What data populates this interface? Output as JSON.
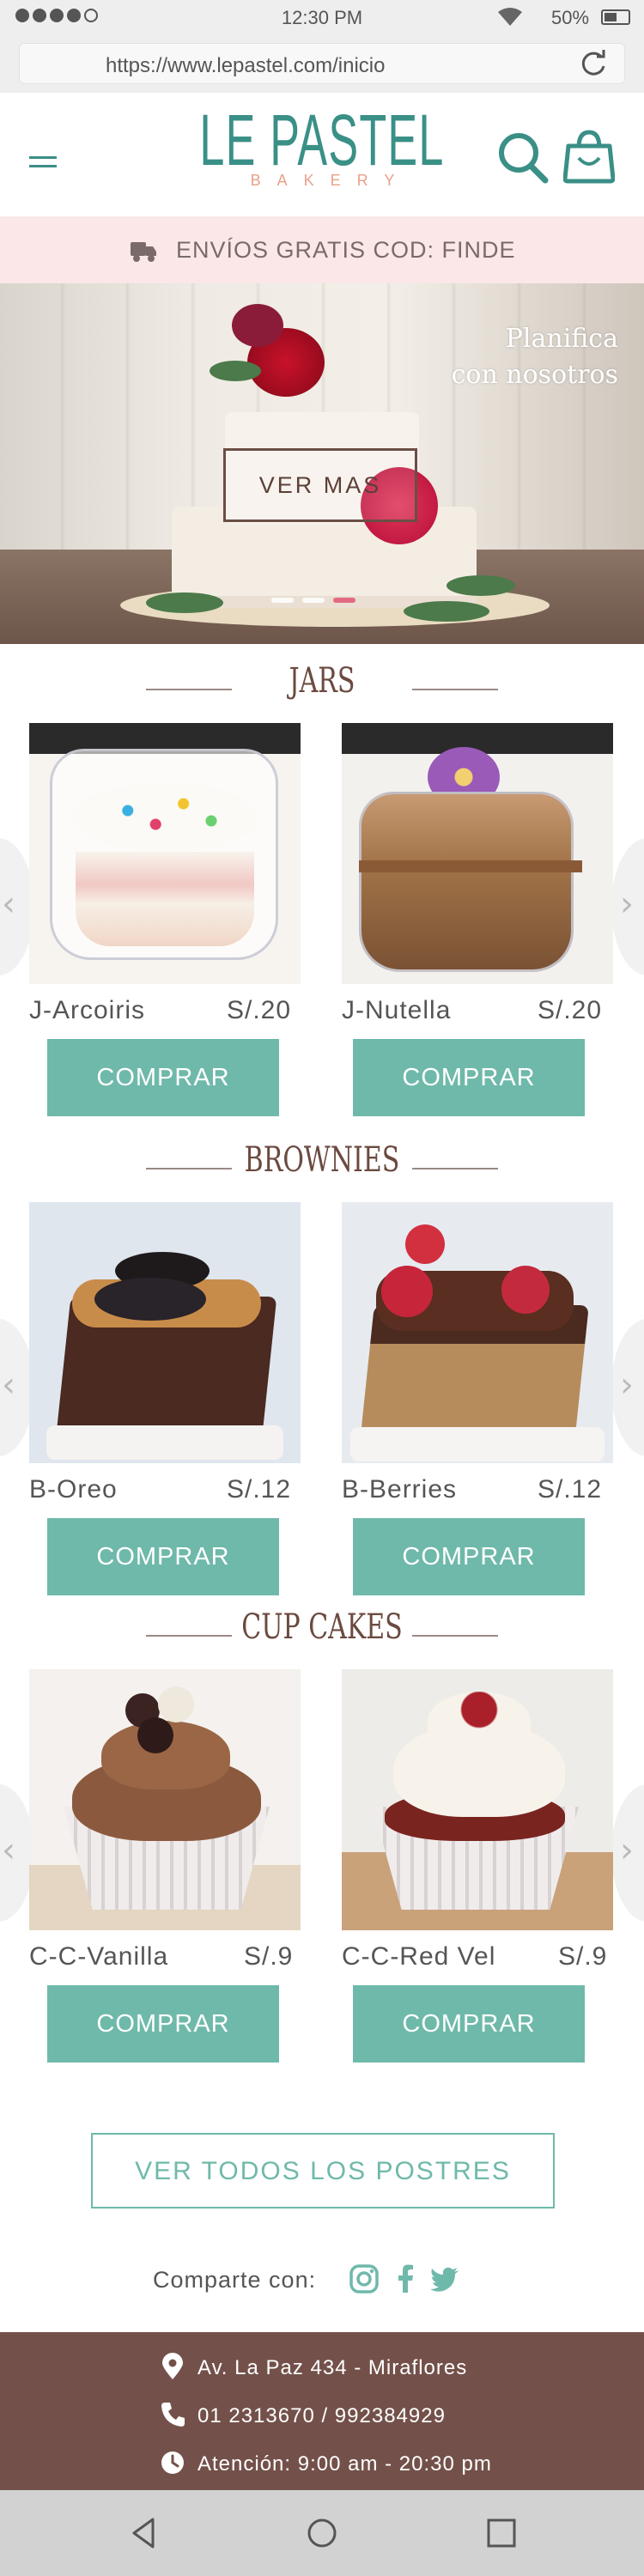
{
  "status_bar": {
    "time": "12:30 PM",
    "battery": "50%"
  },
  "browser": {
    "url": "https://www.lepastel.com/inicio"
  },
  "header": {
    "logo_main": "LE PASTEL",
    "logo_sub": "BAKERY"
  },
  "promo": {
    "text": "ENVÍOS GRATIS  COD: FINDE"
  },
  "hero": {
    "slogan_line1": "Planifica",
    "slogan_line2": "con nosotros",
    "button": "VER MAS",
    "slide_count": 3,
    "active_slide": 3
  },
  "sections": [
    {
      "title": "JARS",
      "products": [
        {
          "name": "J-Arcoiris",
          "price": "S/.20",
          "button": "COMPRAR"
        },
        {
          "name": "J-Nutella",
          "price": "S/.20",
          "button": "COMPRAR"
        }
      ]
    },
    {
      "title": "BROWNIES",
      "products": [
        {
          "name": "B-Oreo",
          "price": "S/.12",
          "button": "COMPRAR"
        },
        {
          "name": "B-Berries",
          "price": "S/.12",
          "button": "COMPRAR"
        }
      ]
    },
    {
      "title": "CUP CAKES",
      "products": [
        {
          "name": "C-C-Vanilla",
          "price": "S/.9",
          "button": "COMPRAR"
        },
        {
          "name": "C-C-Red Vel",
          "price": "S/.9",
          "button": "COMPRAR"
        }
      ]
    }
  ],
  "view_all": "VER TODOS LOS  POSTRES",
  "share": {
    "label": "Comparte con:",
    "networks": [
      "instagram-icon",
      "facebook-icon",
      "twitter-icon"
    ]
  },
  "footer": {
    "address": "Av. La Paz 434 - Miraflores",
    "phone": "01 2313670  /  992384929",
    "hours": "Atención: 9:00 am - 20:30 pm"
  },
  "colors": {
    "teal": "#6fb9aa",
    "logo_teal": "#3a9087",
    "brown": "#73514a",
    "promo_bg": "#fbe7e7",
    "accent_pink": "#e26a82"
  }
}
